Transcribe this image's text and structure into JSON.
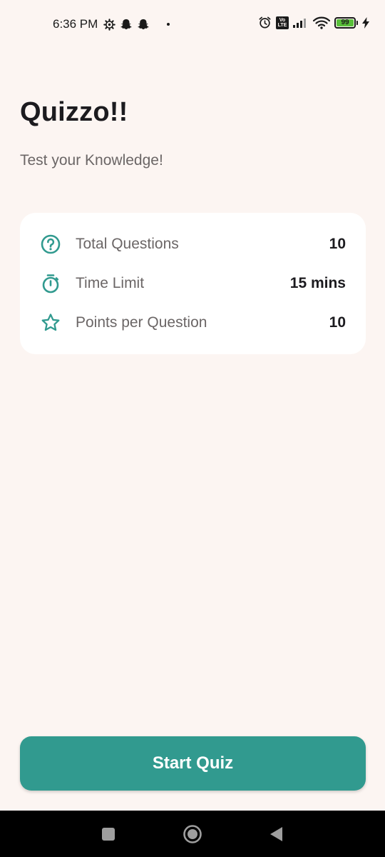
{
  "status_bar": {
    "time": "6:36 PM",
    "left_icons": [
      "settings-gear-icon",
      "snapchat-icon",
      "snapchat-icon"
    ],
    "volte": "Vo\nLTE",
    "volte_top": "Vo",
    "volte_bottom": "LTE",
    "battery_level": "99",
    "right_icons": [
      "alarm-icon",
      "volte-icon",
      "signal-icon",
      "wifi-icon",
      "battery-icon",
      "charging-bolt-icon"
    ]
  },
  "header": {
    "title": "Quizzo!!",
    "subtitle": "Test your Knowledge!"
  },
  "info_card": {
    "rows": [
      {
        "icon": "help-circle-icon",
        "label": "Total Questions",
        "value": "10"
      },
      {
        "icon": "timer-icon",
        "label": "Time Limit",
        "value": "15 mins"
      },
      {
        "icon": "star-outline-icon",
        "label": "Points per Question",
        "value": "10"
      }
    ]
  },
  "actions": {
    "start_label": "Start Quiz"
  },
  "nav_bar": {
    "buttons": [
      "recents-square-icon",
      "home-circle-icon",
      "back-triangle-icon"
    ]
  },
  "colors": {
    "background": "#fcf5f2",
    "accent": "#319a8f",
    "card": "#ffffff",
    "text_primary": "#1c1b1f",
    "text_secondary": "#6b6666"
  }
}
